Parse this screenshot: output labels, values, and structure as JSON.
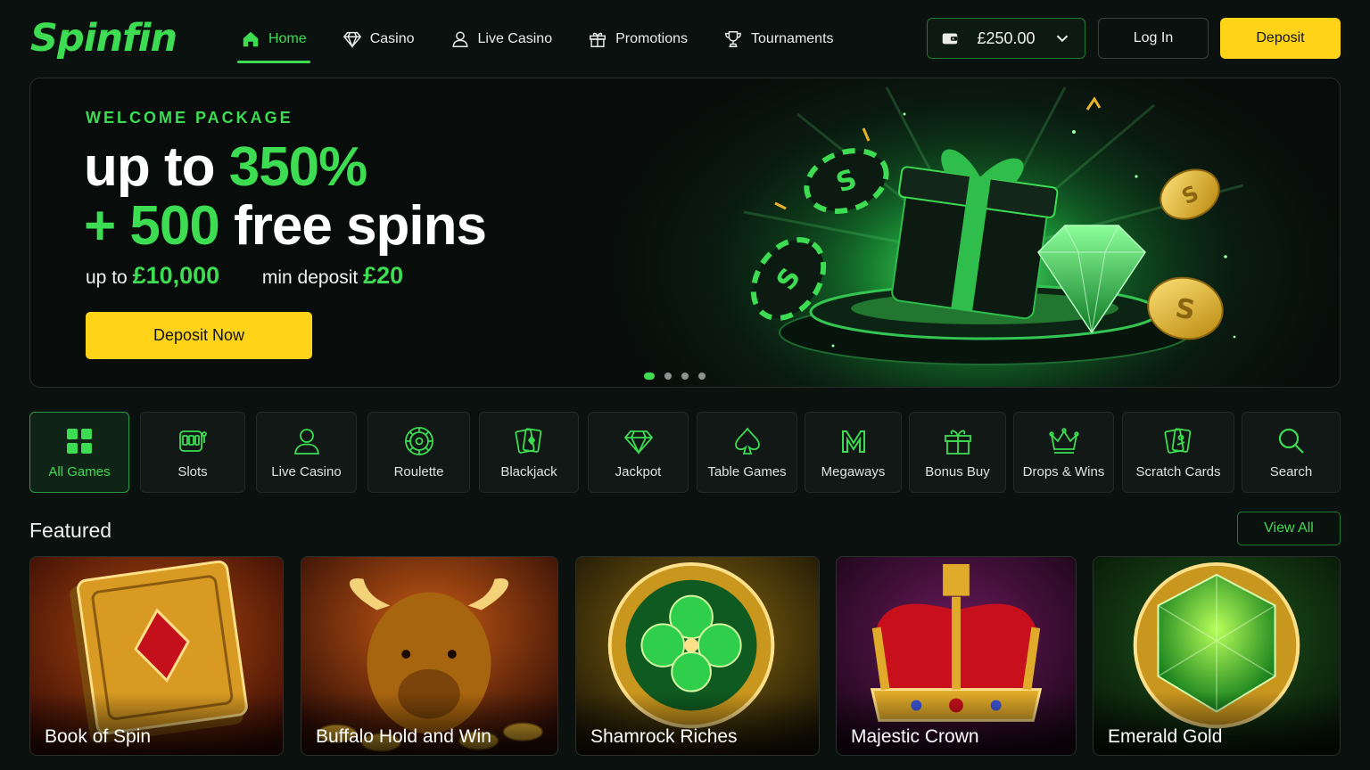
{
  "brand": {
    "logo_text": "Spinfin",
    "accent": "#3ddc52",
    "cta_yellow": "#ffd318"
  },
  "nav": [
    {
      "label": "Home",
      "icon": "home-icon",
      "active": true
    },
    {
      "label": "Casino",
      "icon": "diamond-icon"
    },
    {
      "label": "Live Casino",
      "icon": "user-icon"
    },
    {
      "label": "Promotions",
      "icon": "gift-icon"
    },
    {
      "label": "Tournaments",
      "icon": "trophy-icon"
    }
  ],
  "header": {
    "balance": "£250.00",
    "balance_icon": "wallet-icon",
    "login_label": "Log In",
    "deposit_label": "Deposit"
  },
  "hero": {
    "eyebrow": "WELCOME PACKAGE",
    "line1_pre": "up to ",
    "line1_highlight": "350%",
    "line2_highlight": "+ 500",
    "line2_post": " free spins",
    "sub1_label": "up to",
    "sub1_value": "£10,000",
    "sub2_label": "min deposit",
    "sub2_value": "£20",
    "cta_label": "Deposit Now",
    "slides": 4,
    "active_slide": 1
  },
  "categories": [
    {
      "label": "All Games",
      "icon": "grid-icon",
      "active": true
    },
    {
      "label": "Slots",
      "icon": "slot-machine-icon"
    },
    {
      "label": "Live Casino",
      "icon": "user-icon"
    },
    {
      "label": "Roulette",
      "icon": "roulette-icon"
    },
    {
      "label": "Blackjack",
      "icon": "cards-icon"
    },
    {
      "label": "Jackpot",
      "icon": "diamond-icon"
    },
    {
      "label": "Table Games",
      "icon": "spade-icon"
    },
    {
      "label": "Megaways",
      "icon": "megaways-icon"
    },
    {
      "label": "Bonus Buy",
      "icon": "gift-icon"
    },
    {
      "label": "Drops & Wins",
      "icon": "crown-icon"
    },
    {
      "label": "Scratch Cards",
      "icon": "scratch-card-icon"
    },
    {
      "label": "Search",
      "icon": "search-icon"
    }
  ],
  "featured": {
    "title": "Featured",
    "view_all_label": "View All",
    "games": [
      {
        "title": "Book of Spin",
        "art": "golden-book-art"
      },
      {
        "title": "Buffalo Hold and Win",
        "art": "buffalo-art"
      },
      {
        "title": "Shamrock Riches",
        "art": "shamrock-art"
      },
      {
        "title": "Majestic Crown",
        "art": "crown-art"
      },
      {
        "title": "Emerald Gold",
        "art": "emerald-art"
      }
    ]
  }
}
